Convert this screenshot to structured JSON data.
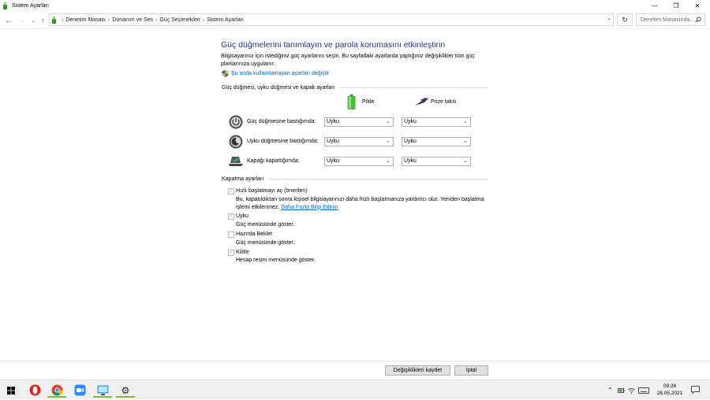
{
  "window": {
    "title": "Sistem Ayarları",
    "minimize": "—",
    "maximize": "❐",
    "close": "✕"
  },
  "address": {
    "crumbs": [
      "Denetim Masası",
      "Donanım ve Ses",
      "Güç Seçenekleri",
      "Sistem Ayarları"
    ],
    "search_placeholder": "Denetim Masasında..."
  },
  "content": {
    "title": "Güç düğmelerini tanımlayın ve parola korumasını etkinleştirin",
    "description": "Bilgisayarınız için istediğiniz güç ayarlarını seçin. Bu sayfadaki ayarlarda yaptığınız değişiklikler tüm güç planlarınıza uygulanır.",
    "change_link": "Şu anda kullanılamayan ayarları değiştir",
    "power_section": "Güç düğmesi, uyku düğmesi ve kapak ayarları",
    "col_battery": "Pilde",
    "col_plugged": "Prize takılı",
    "rows": [
      {
        "label": "Güç düğmesine bastığımda:",
        "battery": "Uyku",
        "plugged": "Uyku"
      },
      {
        "label": "Uyku düğmesine bastığımda:",
        "battery": "Uyku",
        "plugged": "Uyku"
      },
      {
        "label": "Kapağı kapattığımda:",
        "battery": "Uyku",
        "plugged": "Uyku"
      }
    ],
    "shutdown_section": "Kapatma ayarları",
    "shutdown_options": [
      {
        "label": "Hızlı başlatmayı aç (önerilen)",
        "checked": true,
        "desc_line1": "Bu, kapatıldıktan sonra kişisel bilgisayarınızı daha hızlı başlatmanıza yardımcı olur. Yeniden başlatma",
        "desc_line2": "işlemi etkilenmez.",
        "link": "Daha Fazla Bilgi Edinin"
      },
      {
        "label": "Uyku",
        "checked": true,
        "desc_line1": "Güç menüsünde göster."
      },
      {
        "label": "Hazırda Beklet",
        "checked": false,
        "desc_line1": "Güç menüsünde göster."
      },
      {
        "label": "Kilitle",
        "checked": true,
        "desc_line1": "Hesap resmi menüsünde göster."
      }
    ]
  },
  "buttons": {
    "save": "Değişiklikleri kaydet",
    "cancel": "İptal"
  },
  "taskbar": {
    "time": "09:28",
    "date": "28.05.2021"
  }
}
